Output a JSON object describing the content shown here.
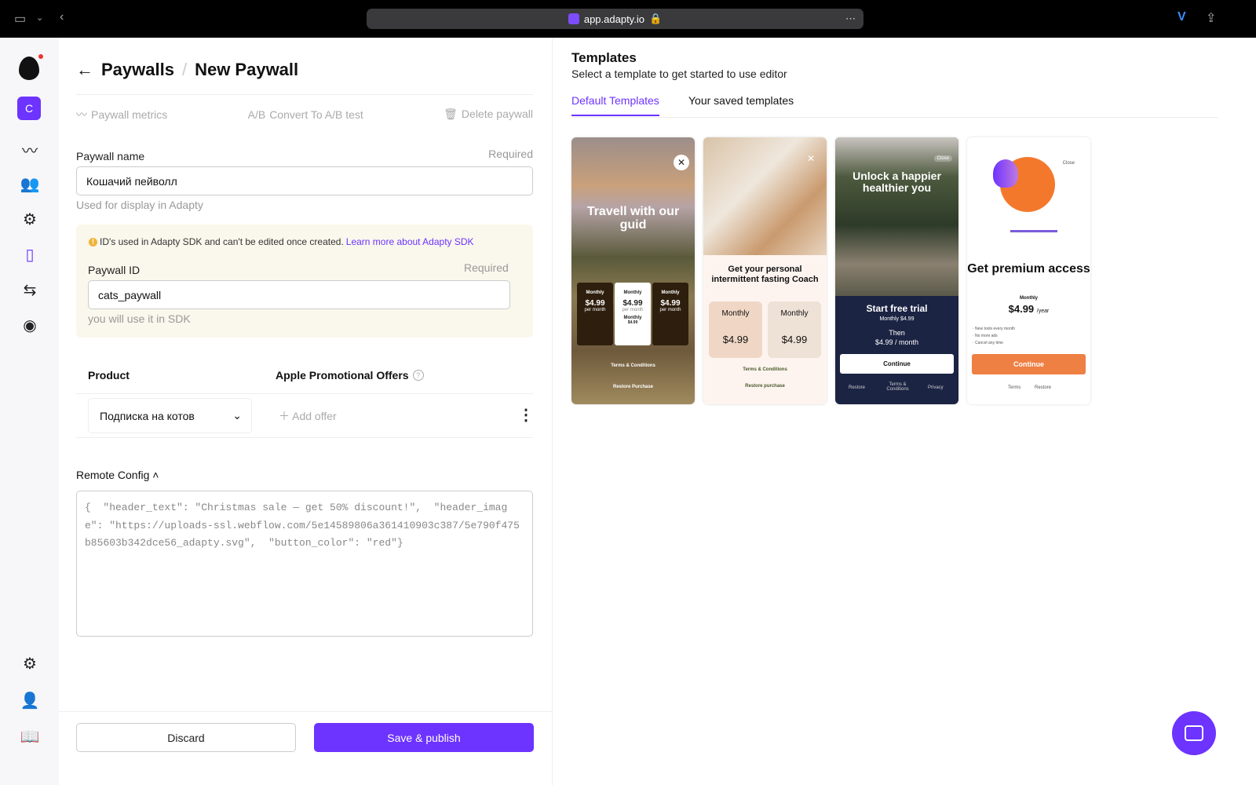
{
  "browser": {
    "url": "app.adapty.io"
  },
  "sidebar": {
    "workspace_initial": "C"
  },
  "header": {
    "back_label": "Paywalls",
    "title": "New Paywall"
  },
  "actions": {
    "metrics": "Paywall metrics",
    "ab_icon": "A/B",
    "convert": "Convert To A/B test",
    "delete": "Delete paywall"
  },
  "form": {
    "name_label": "Paywall name",
    "name_required": "Required",
    "name_value": "Кошачий пейволл",
    "name_hint": "Used for display in Adapty",
    "id_warning": "ID's used in Adapty SDK and can't be edited once created.",
    "id_warning_link": "Learn more about Adapty SDK",
    "id_label": "Paywall ID",
    "id_required": "Required",
    "id_value": "cats_paywall",
    "id_hint": "you will use it in SDK",
    "product_header": "Product",
    "offers_header": "Apple Promotional Offers",
    "product_value": "Подписка на котов",
    "add_offer": "Add offer",
    "remote_config_label": "Remote Config",
    "remote_config_value": "{  \"header_text\": \"Christmas sale — get 50% discount!\",  \"header_image\": \"https://uploads-ssl.webflow.com/5e14589806a361410903c387/5e790f475b85603b342dce56_adapty.svg\",  \"button_color\": \"red\"}"
  },
  "footer": {
    "discard": "Discard",
    "save": "Save & publish"
  },
  "templates": {
    "title": "Templates",
    "subtitle": "Select a template to get started to use editor",
    "tabs": [
      "Default Templates",
      "Your saved templates"
    ],
    "cards": [
      {
        "headline": "Travell with our guid",
        "plans": [
          {
            "label": "Monthly",
            "price": "$4.99",
            "period": "per month"
          },
          {
            "label": "Monthly",
            "price": "$4.99",
            "period": "per month",
            "extra_label": "Monthly",
            "extra_price": "$4.99"
          },
          {
            "label": "Monthly",
            "price": "$4.99",
            "period": "per month"
          }
        ],
        "terms": "Terms & Conditions",
        "restore": "Restore Purchase"
      },
      {
        "headline": "Get your personal intermittent fasting Coach",
        "plans": [
          {
            "label": "Monthly",
            "price": "$4.99"
          },
          {
            "label": "Monthly",
            "price": "$4.99"
          }
        ],
        "terms": "Terms & Conditions",
        "restore": "Restore purchase"
      },
      {
        "close": "Close",
        "headline": "Unlock a happier healthier you",
        "cta_title": "Start free trial",
        "plan": "Monthly  $4.99",
        "then": "Then",
        "then_price": "$4.99 / month",
        "button": "Continue",
        "links": [
          "Restore",
          "Terms & Conditions",
          "Privacy"
        ]
      },
      {
        "close": "Close",
        "headline": "Get premium access",
        "plan": "Monthly",
        "price": "$4.99",
        "period": "/year",
        "features": [
          "· New tools every month",
          "· No more ads",
          "· Cancel any time"
        ],
        "button": "Continue",
        "links": [
          "Terms",
          "Restore"
        ]
      }
    ]
  }
}
